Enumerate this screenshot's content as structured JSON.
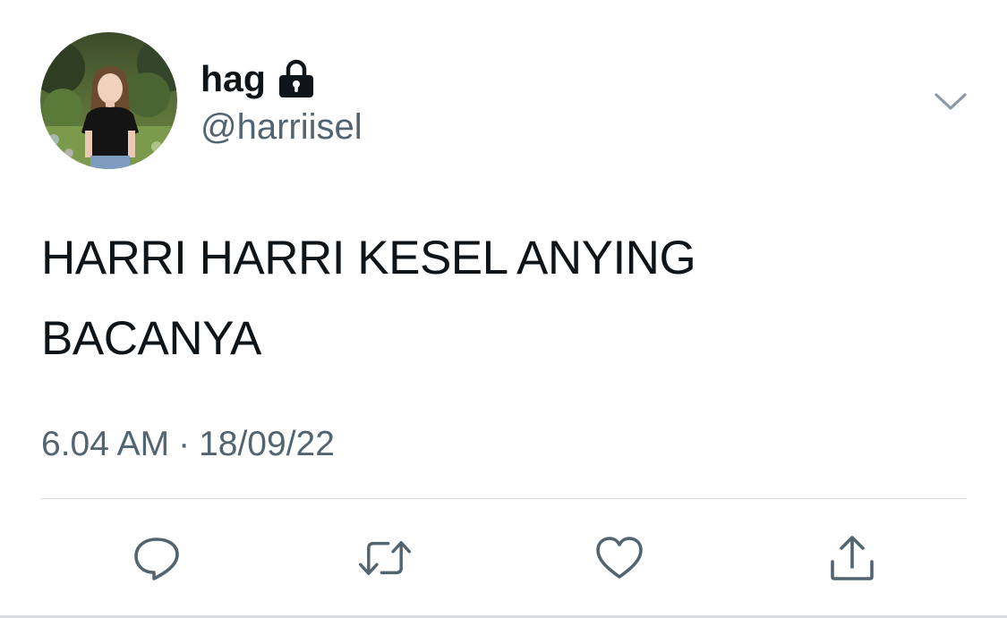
{
  "tweet": {
    "display_name": "hag",
    "handle": "@harriisel",
    "text": "HARRI HARRI KESEL ANYING\nBACANYA",
    "time": "6.04 AM",
    "separator": "·",
    "date": "18/09/22",
    "protected_icon": "lock-icon",
    "menu_icon": "chevron-down-icon"
  },
  "actions": [
    {
      "name": "reply",
      "icon": "reply-icon"
    },
    {
      "name": "retweet",
      "icon": "retweet-icon"
    },
    {
      "name": "like",
      "icon": "heart-icon"
    },
    {
      "name": "share",
      "icon": "share-icon"
    }
  ],
  "colors": {
    "text_primary": "#0f1419",
    "text_secondary": "#536471",
    "icon": "#536471",
    "divider": "#d8dde1",
    "background": "#ffffff"
  }
}
